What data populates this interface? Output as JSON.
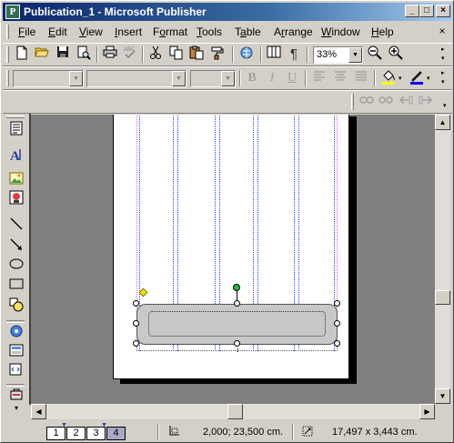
{
  "window": {
    "title": "Publication_1 - Microsoft Publisher",
    "app_icon_letter": "P",
    "minimize_glyph": "_",
    "maximize_glyph": "□",
    "close_glyph": "×"
  },
  "menu": {
    "items": [
      {
        "label": "File",
        "accel": "F",
        "rest": "ile"
      },
      {
        "label": "Edit",
        "accel": "E",
        "rest": "dit"
      },
      {
        "label": "View",
        "accel": "V",
        "rest": "iew"
      },
      {
        "label": "Insert",
        "accel": "I",
        "rest": "nsert"
      },
      {
        "label": "Format",
        "accel": "o",
        "pre": "F",
        "rest": "rmat"
      },
      {
        "label": "Tools",
        "accel": "T",
        "rest": "ools"
      },
      {
        "label": "Table",
        "accel": "a",
        "pre": "T",
        "rest": "ble"
      },
      {
        "label": "Arrange",
        "accel": "r",
        "pre": "A",
        "rest": "range"
      },
      {
        "label": "Window",
        "accel": "W",
        "rest": "indow"
      },
      {
        "label": "Help",
        "accel": "H",
        "rest": "elp"
      }
    ],
    "close_doc_glyph": "×"
  },
  "standard_toolbar": {
    "zoom_value": "33%",
    "icons": [
      "new-icon",
      "open-icon",
      "save-icon",
      "print-preview-icon",
      "print-icon",
      "spelling-icon",
      "cut-icon",
      "copy-icon",
      "paste-icon",
      "format-painter-icon",
      "insert-hyperlink-icon",
      "columns-icon",
      "pilcrow-icon",
      "zoom-out-icon",
      "zoom-in-icon"
    ]
  },
  "formatting_toolbar": {
    "style_value": "",
    "font_value": "",
    "size_value": "",
    "bold": "B",
    "italic": "I",
    "underline": "U",
    "fill_color": "#ffff00",
    "line_color": "#0000ff"
  },
  "status": {
    "pages": [
      "1",
      "2",
      "3",
      "4"
    ],
    "active_page": "4",
    "position": "2,000; 23,500 cm.",
    "size": "17,497 x   3,443 cm."
  },
  "colors": {
    "titlebar_start": "#0a246a",
    "titlebar_end": "#a6caf0",
    "workspace": "#808080",
    "guide_pink": "#e060d0",
    "guide_blue": "#2040ff",
    "shape_fill": "#c8c8c8",
    "rotation_handle": "#18c030",
    "adjust_handle": "#ffe000"
  }
}
